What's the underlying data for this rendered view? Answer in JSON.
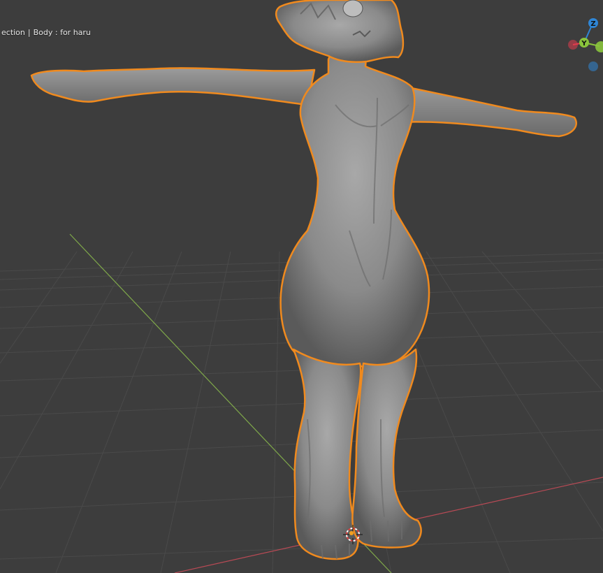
{
  "viewport": {
    "overlay": {
      "view_label": "ection",
      "separator": "|",
      "object_label": "Body : for haru"
    }
  },
  "gizmo": {
    "z_label": "Z",
    "y_label": "Y",
    "x_color": "#e23c4e",
    "y_color": "#8ac43c",
    "z_color": "#2f86d6"
  },
  "colors": {
    "background": "#3d3d3d",
    "grid": "#4a4a4a",
    "x_axis": "#b94a55",
    "y_axis": "#7fa84a",
    "selection_outline": "#f08a1e",
    "mesh": "#8a8a8a"
  }
}
